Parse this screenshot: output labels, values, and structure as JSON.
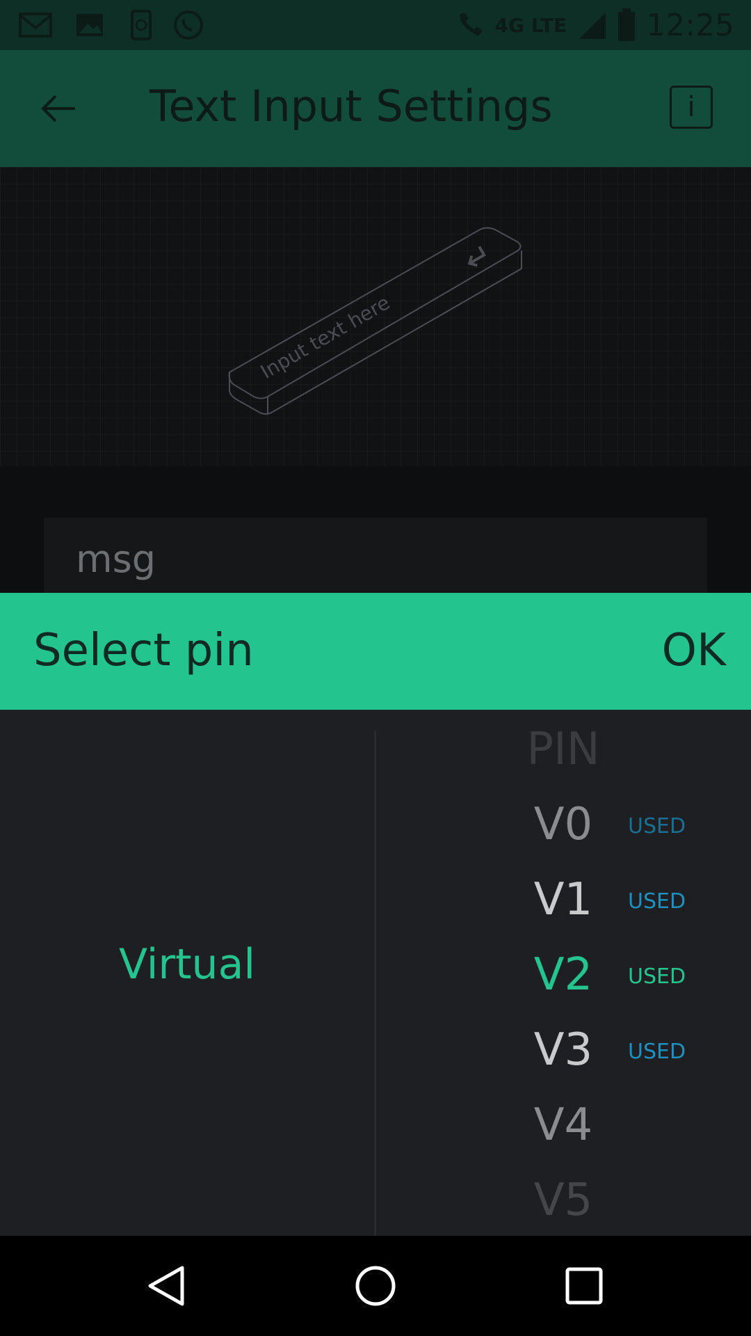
{
  "status_bar": {
    "icons": [
      "gmail-icon",
      "image-icon",
      "phone-sync-icon",
      "whatsapp-icon"
    ],
    "network": "4G LTE",
    "time": "12:25"
  },
  "app_bar": {
    "title": "Text Input Settings",
    "back_icon": "arrow-left-icon",
    "info_icon": "info-icon",
    "info_label": "i"
  },
  "preview": {
    "placeholder": "Input text here"
  },
  "name_field": {
    "value": "msg"
  },
  "sheet": {
    "title": "Select pin",
    "ok_label": "OK"
  },
  "picker": {
    "type_value": "Virtual",
    "header": "PIN",
    "pins": [
      {
        "label": "V0",
        "used": "USED"
      },
      {
        "label": "V1",
        "used": "USED"
      },
      {
        "label": "V2",
        "used": "USED",
        "selected": true
      },
      {
        "label": "V3",
        "used": "USED"
      },
      {
        "label": "V4",
        "used": ""
      },
      {
        "label": "V5",
        "used": ""
      }
    ]
  },
  "nav_bar": {
    "icons": [
      "back-triangle-icon",
      "home-circle-icon",
      "recents-square-icon"
    ]
  },
  "colors": {
    "accent": "#24c48e",
    "used": "#1f8fbf",
    "appbar": "#124d3c"
  }
}
